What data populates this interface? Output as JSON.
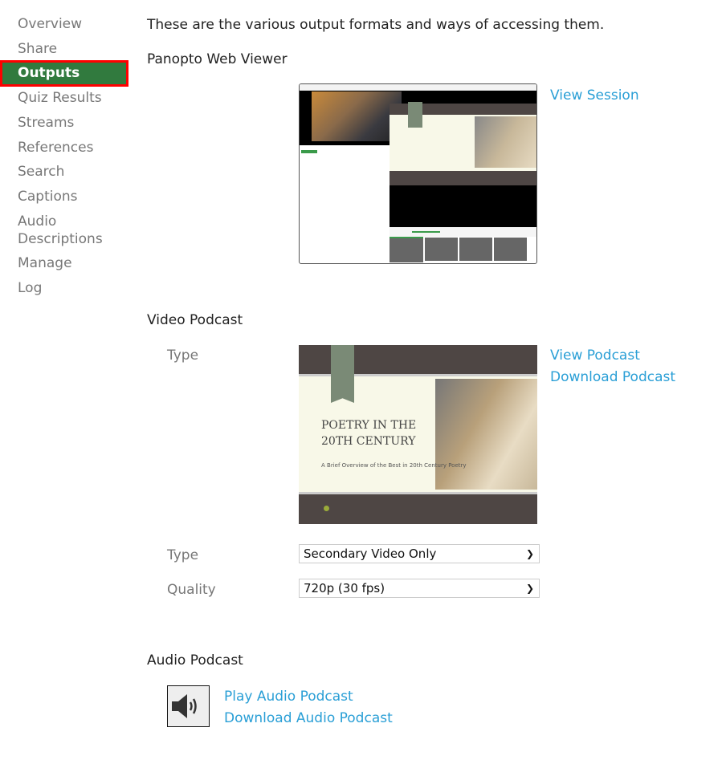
{
  "sidebar": {
    "items": [
      {
        "label": "Overview"
      },
      {
        "label": "Share"
      },
      {
        "label": "Outputs",
        "active": true
      },
      {
        "label": "Quiz Results"
      },
      {
        "label": "Streams"
      },
      {
        "label": "References"
      },
      {
        "label": "Search"
      },
      {
        "label": "Captions"
      },
      {
        "label": "Audio Descriptions"
      },
      {
        "label": "Manage"
      },
      {
        "label": "Log"
      }
    ]
  },
  "main": {
    "intro": "These are the various output formats and ways of accessing them.",
    "web_viewer": {
      "heading": "Panopto Web Viewer",
      "link": "View Session"
    },
    "video_podcast": {
      "heading": "Video Podcast",
      "type_label": "Type",
      "view_link": "View Podcast",
      "download_link": "Download Podcast",
      "type_select_label": "Type",
      "type_value": "Secondary Video Only",
      "quality_label": "Quality",
      "quality_value": "720p (30 fps)"
    },
    "audio_podcast": {
      "heading": "Audio Podcast",
      "icon": "speaker-icon",
      "play_link": "Play Audio Podcast",
      "download_link": "Download Audio Podcast"
    },
    "slide": {
      "title": "POETRY IN THE 20TH CENTURY",
      "subtitle": "A Brief Overview of the Best in 20th Century Poetry"
    }
  },
  "colors": {
    "active_bg": "#317a3e",
    "active_border": "#ff0000",
    "link": "#2a9fd6"
  }
}
